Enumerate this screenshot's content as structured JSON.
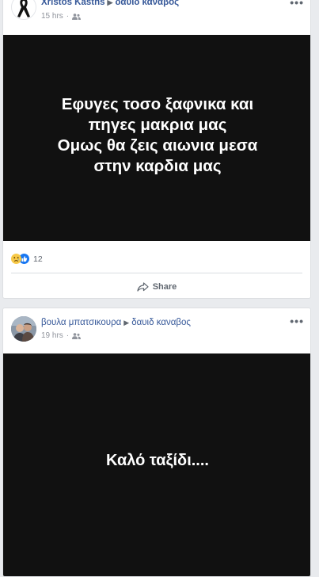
{
  "posts": [
    {
      "author": "Xristos Kasths",
      "recipient": "δαυιδ καναβος",
      "time": "15 hrs",
      "caption_lines": [
        "Εφυγες τοσο ξαφνικα και",
        "πηγες μακρια μας",
        "Ομως θα ζεις αιωνια μεσα",
        "στην καρδια μας"
      ],
      "reaction_count": "12",
      "share_label": "Share"
    },
    {
      "author": "βουλα μπατσικουρα",
      "recipient": "δαυιδ καναβος",
      "time": "19 hrs",
      "caption_lines": [
        "Καλό ταξίδι...."
      ]
    }
  ],
  "icons": {
    "avatar1": "black-ribbon-icon",
    "avatar2": "user-photo",
    "privacy": "friends-icon",
    "more": "more-options-icon",
    "arrow": "triangle-right-icon",
    "reactions": [
      "sad-reaction-icon",
      "like-reaction-icon"
    ],
    "share": "share-arrow-icon"
  },
  "colors": {
    "link": "#365899",
    "media_bg": "#111111",
    "page_bg": "#e9ebee",
    "like": "#1877f2",
    "sad": "#f7c948"
  }
}
